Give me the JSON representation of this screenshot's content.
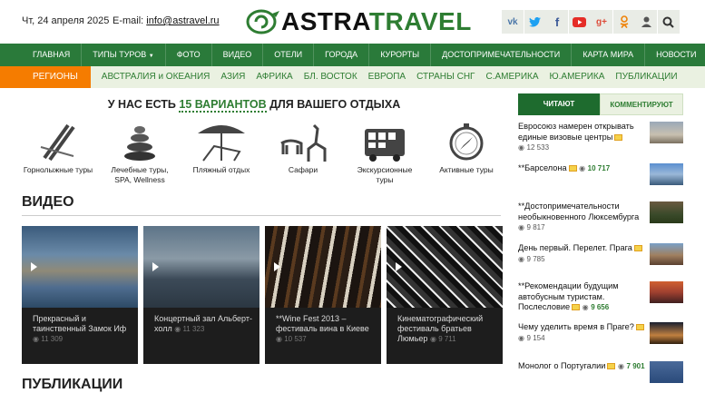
{
  "header": {
    "date": "Чт, 24 апреля 2025",
    "email_label": "E-mail:",
    "email": "info@astravel.ru",
    "logo_text_a": "ASTRA",
    "logo_text_b": "TRAVEL",
    "social": [
      "vk-icon",
      "twitter-icon",
      "facebook-icon",
      "youtube-icon",
      "google-plus-icon",
      "odnoklassniki-icon",
      "user-icon",
      "search-icon"
    ]
  },
  "nav1": [
    "ГЛАВНАЯ",
    "ТИПЫ ТУРОВ",
    "ФОТО",
    "ВИДЕО",
    "ОТЕЛИ",
    "ГОРОДА",
    "КУРОРТЫ",
    "ДОСТОПРИМЕЧАТЕЛЬНОСТИ",
    "КАРТА МИРА",
    "НОВОСТИ"
  ],
  "nav2": [
    "РЕГИОНЫ",
    "АВСТРАЛИЯ и ОКЕАНИЯ",
    "АЗИЯ",
    "АФРИКА",
    "БЛ. ВОСТОК",
    "ЕВРОПА",
    "СТРАНЫ СНГ",
    "С.АМЕРИКА",
    "Ю.АМЕРИКА",
    "ПУБЛИКАЦИИ"
  ],
  "variants": {
    "a": "У НАС ЕСТЬ ",
    "b": "15 ВАРИАНТОВ",
    "c": " ДЛЯ ВАШЕГО ОТДЫХА"
  },
  "tours": [
    "Горнолыжные туры",
    "Лечебные туры, SPA, Wellness",
    "Пляжный отдых",
    "Сафари",
    "Экскурсионные туры",
    "Активные туры"
  ],
  "video_heading": "ВИДЕО",
  "videos": [
    {
      "title": "Прекрасный и таинственный Замок Иф",
      "views": "11 309"
    },
    {
      "title": "Концертный зал Альберт-холл",
      "views": "11 323"
    },
    {
      "title": "**Wine Fest 2013 – фестиваль вина в Киеве",
      "views": "10 537"
    },
    {
      "title": "Кинематографический фестиваль братьев Люмьер",
      "views": "9 711"
    }
  ],
  "pubs_heading": "ПУБЛИКАЦИИ",
  "side_tabs": [
    "ЧИТАЮТ",
    "КОММЕНТИРУЮТ"
  ],
  "news": [
    {
      "title": "Евросоюз намерен открывать единые визовые центры",
      "views": "12 533"
    },
    {
      "title": "**Барселона",
      "views": "10 717"
    },
    {
      "title": "**Достопримечательности необыкновенного Люксембурга",
      "views": "9 817"
    },
    {
      "title": "День первый. Перелет. Прага",
      "views": "9 785"
    },
    {
      "title": "**Рекомендации будущим автобусным туристам. Послесловие",
      "views": "9 656"
    },
    {
      "title": "Чему уделить время в Праге?",
      "views": "9 154"
    },
    {
      "title": "Монолог о Португалии",
      "views": "7 901"
    }
  ],
  "colors": {
    "green": "#2a7a3a",
    "light": "#eaf1e1",
    "orange": "#f57c00"
  }
}
